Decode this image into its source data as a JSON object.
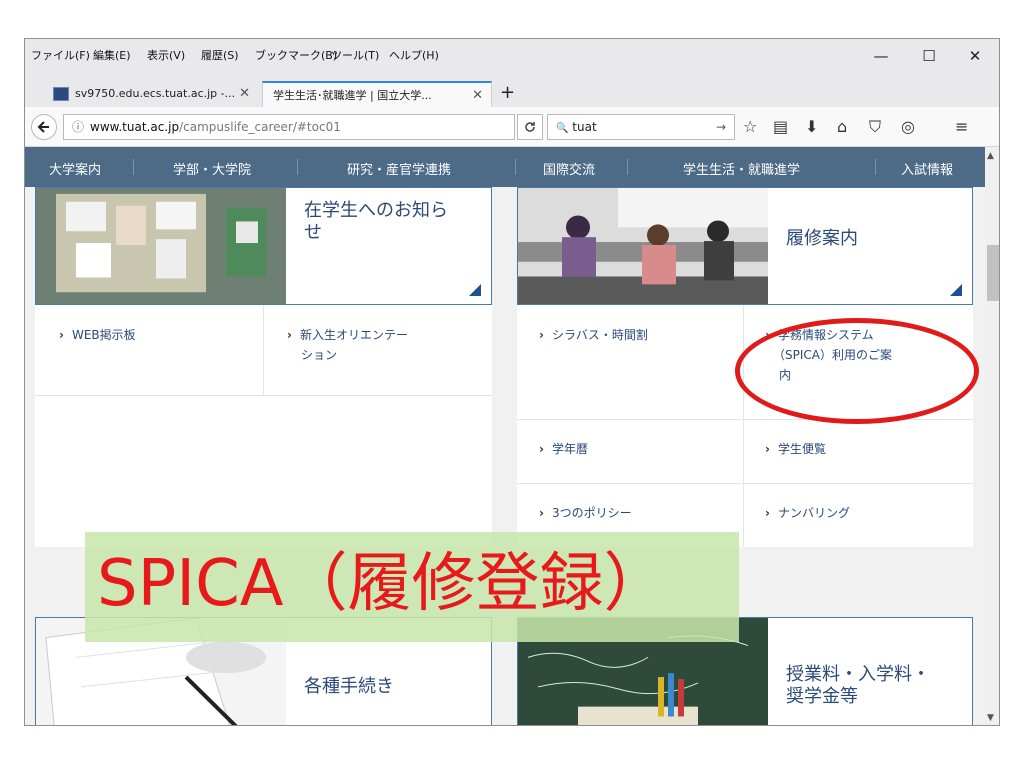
{
  "menu": [
    "ファイル(F)",
    "編集(E)",
    "表示(V)",
    "履歴(S)",
    "ブックマーク(B)",
    "ツール(T)",
    "ヘルプ(H)"
  ],
  "window_controls": {
    "minimize": "—",
    "maximize": "☐",
    "close": "✕"
  },
  "tabs": [
    {
      "label": "sv9750.edu.ecs.tuat.ac.jp -...",
      "close": "✕"
    },
    {
      "label": "学生生活･就職進学 | 国立大学...",
      "close": "✕"
    }
  ],
  "newtab": "+",
  "url": {
    "domain": "www.tuat.ac.jp",
    "path": "/campuslife_career/#toc01",
    "info": "ⓘ"
  },
  "search": {
    "icon": "🔍",
    "value": "tuat",
    "go": "→"
  },
  "toolbar_icons": [
    "☆",
    "▤",
    "⬇",
    "⌂",
    "⛉",
    "◎",
    "≡"
  ],
  "site_nav": [
    "大学案内",
    "学部・大学院",
    "研究・産官学連携",
    "国際交流",
    "学生生活・就職進学",
    "入試情報"
  ],
  "cards": {
    "notices": {
      "title_lines": [
        "在学生へのお知ら",
        "せ"
      ]
    },
    "courses": {
      "title_lines": [
        "履修案内"
      ]
    },
    "procedures": {
      "title_lines": [
        "各種手続き"
      ]
    },
    "fees": {
      "title_lines": [
        "授業料・入学料・",
        "奨学金等"
      ]
    }
  },
  "left_links": [
    {
      "lines": [
        "WEB掲示板"
      ]
    },
    {
      "lines": [
        "新入生オリエンテー",
        "ション"
      ]
    }
  ],
  "right_links": [
    {
      "lines": [
        "シラバス・時間割"
      ]
    },
    {
      "lines": [
        "学務情報システム",
        "（SPICA）利用のご案",
        "内"
      ]
    },
    {
      "lines": [
        "学年暦"
      ]
    },
    {
      "lines": [
        "学生便覧"
      ]
    },
    {
      "lines": [
        "3つのポリシー"
      ]
    },
    {
      "lines": [
        "ナンバリング"
      ]
    }
  ],
  "overlay_text": "SPICA（履修登録）",
  "colors": {
    "nav_bg": "#4d6a87",
    "card_border": "#4a78b0",
    "highlight_ring": "#e11a1a",
    "overlay_text": "#e8191a"
  }
}
